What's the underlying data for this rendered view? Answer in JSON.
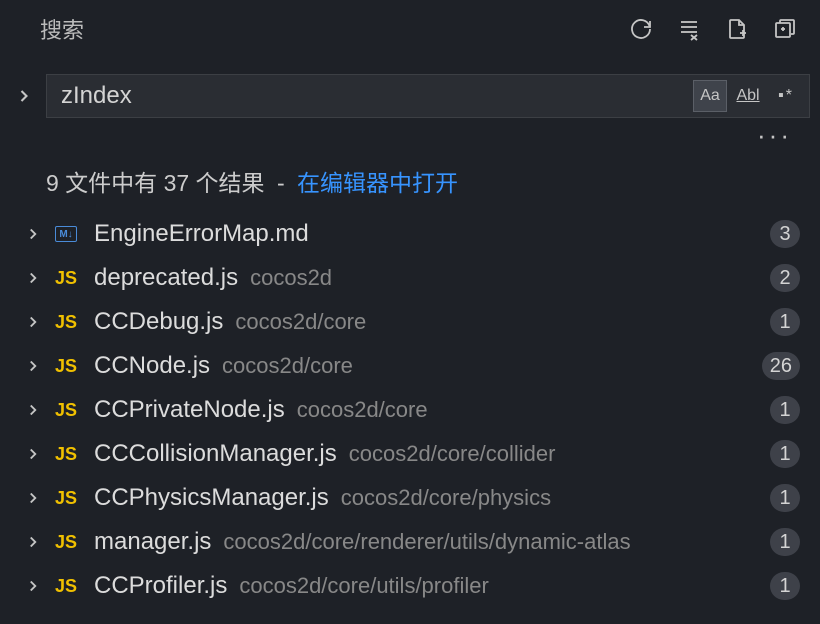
{
  "header": {
    "title": "搜索"
  },
  "search": {
    "query": "zIndex",
    "matchCase": "Aa",
    "wholeWord": "Abl",
    "regex": "▪*"
  },
  "summary": {
    "part1": "9 文件中有 37 个结果",
    "dash": "-",
    "link": "在编辑器中打开"
  },
  "results": [
    {
      "iconType": "md",
      "name": "EngineErrorMap.md",
      "path": "",
      "count": 3
    },
    {
      "iconType": "js",
      "name": "deprecated.js",
      "path": "cocos2d",
      "count": 2
    },
    {
      "iconType": "js",
      "name": "CCDebug.js",
      "path": "cocos2d/core",
      "count": 1
    },
    {
      "iconType": "js",
      "name": "CCNode.js",
      "path": "cocos2d/core",
      "count": 26
    },
    {
      "iconType": "js",
      "name": "CCPrivateNode.js",
      "path": "cocos2d/core",
      "count": 1
    },
    {
      "iconType": "js",
      "name": "CCCollisionManager.js",
      "path": "cocos2d/core/collider",
      "count": 1
    },
    {
      "iconType": "js",
      "name": "CCPhysicsManager.js",
      "path": "cocos2d/core/physics",
      "count": 1
    },
    {
      "iconType": "js",
      "name": "manager.js",
      "path": "cocos2d/core/renderer/utils/dynamic-atlas",
      "count": 1
    },
    {
      "iconType": "js",
      "name": "CCProfiler.js",
      "path": "cocos2d/core/utils/profiler",
      "count": 1
    }
  ]
}
